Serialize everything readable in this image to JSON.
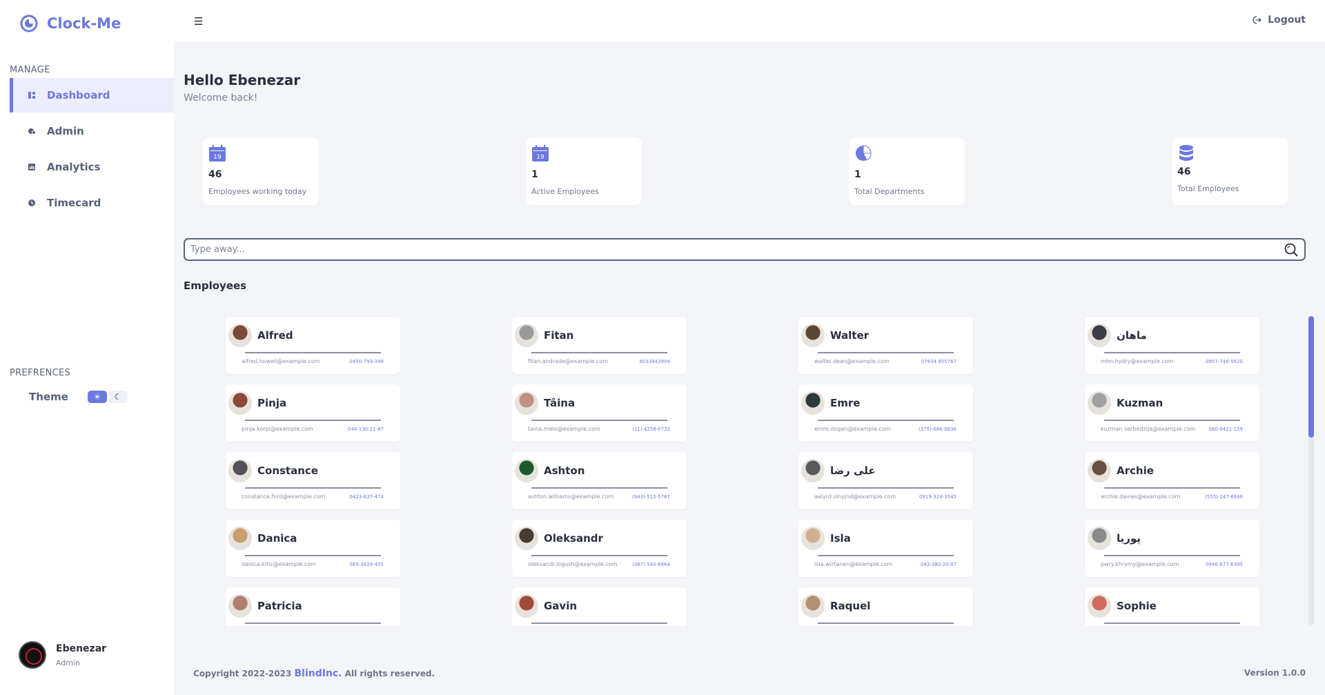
{
  "brand": {
    "name": "Clock-Me",
    "accent": "#6c78e0"
  },
  "sidebar": {
    "manage_label": "MANAGE",
    "items": [
      {
        "label": "Dashboard",
        "icon": "dashboard-icon",
        "active": true
      },
      {
        "label": "Admin",
        "icon": "admin-icon",
        "active": false
      },
      {
        "label": "Analytics",
        "icon": "analytics-icon",
        "active": false
      },
      {
        "label": "Timecard",
        "icon": "clock-icon",
        "active": false
      }
    ],
    "preferences_label": "PREFRENCES",
    "theme_label": "Theme",
    "theme_mode": "light"
  },
  "user": {
    "name": "Ebenezar",
    "role": "Admin"
  },
  "topbar": {
    "logout_label": "Logout"
  },
  "greeting": {
    "title": "Hello Ebenezar",
    "subtitle": "Welcome back!"
  },
  "stats": [
    {
      "value": "46",
      "label": "Employees working today",
      "icon": "calendar-icon",
      "icon_text": "19"
    },
    {
      "value": "1",
      "label": "Active Employees",
      "icon": "calendar-icon",
      "icon_text": "19"
    },
    {
      "value": "1",
      "label": "Total Departments",
      "icon": "pie-chart-icon"
    },
    {
      "value": "46",
      "label": "Total Employees",
      "icon": "database-icon"
    }
  ],
  "search": {
    "placeholder": "Type away..."
  },
  "employees_heading": "Employees",
  "employees": [
    {
      "name": "Alfred",
      "email": "alfred.howell@example.com",
      "phone": "0450-793-398",
      "avatar_color": "#7a4a3a"
    },
    {
      "name": "Fitan",
      "email": "fitan.andrade@example.com",
      "phone": "8033943904",
      "avatar_color": "#9a9a9a"
    },
    {
      "name": "Walter",
      "email": "walter.dean@example.com",
      "phone": "07634 955767",
      "avatar_color": "#5a4636"
    },
    {
      "name": "ماهان",
      "email": "mhn.hydry@example.com",
      "phone": "0957-746-5620",
      "avatar_color": "#3c3c46"
    },
    {
      "name": "Pinja",
      "email": "pinja.korpi@example.com",
      "phone": "044-130-21-87",
      "avatar_color": "#8a4a3a"
    },
    {
      "name": "Tâina",
      "email": "taina.melo@example.com",
      "phone": "(11) 4258-0733",
      "avatar_color": "#c09080"
    },
    {
      "name": "Emre",
      "email": "emre.dogan@example.com",
      "phone": "(375)-686-0836",
      "avatar_color": "#2e3a3a"
    },
    {
      "name": "Kuzman",
      "email": "kuzman.serbedzija@example.com",
      "phone": "060-9421-159",
      "avatar_color": "#a0a0a0"
    },
    {
      "name": "Constance",
      "email": "constance.ford@example.com",
      "phone": "0423-637-474",
      "avatar_color": "#555058"
    },
    {
      "name": "Ashton",
      "email": "ashton.williams@example.com",
      "phone": "(943)-512-5767",
      "avatar_color": "#1e5a2e"
    },
    {
      "name": "علی رضا",
      "email": "aalyrd.slnyjnd@example.com",
      "phone": "0919-324-3545",
      "avatar_color": "#5a5a5a"
    },
    {
      "name": "Archie",
      "email": "archie.davies@example.com",
      "phone": "(555)-147-6946",
      "avatar_color": "#6a5040"
    },
    {
      "name": "Danica",
      "email": "danica.kitic@example.com",
      "phone": "065-3828-455",
      "avatar_color": "#c8a070"
    },
    {
      "name": "Oleksandr",
      "email": "oleksandr.logush@example.com",
      "phone": "(067) 540-6864",
      "avatar_color": "#4a3a30"
    },
    {
      "name": "Isla",
      "email": "isla.wirtanen@example.com",
      "phone": "043-380-20-07",
      "avatar_color": "#d0b090"
    },
    {
      "name": "پوریا",
      "email": "pwry.khrymy@example.com",
      "phone": "0946-877-6395",
      "avatar_color": "#8a8a8a"
    },
    {
      "name": "Patricia",
      "email": "",
      "phone": "",
      "avatar_color": "#b08070"
    },
    {
      "name": "Gavin",
      "email": "",
      "phone": "",
      "avatar_color": "#a04a3a"
    },
    {
      "name": "Raquel",
      "email": "",
      "phone": "",
      "avatar_color": "#b09070"
    },
    {
      "name": "Sophie",
      "email": "",
      "phone": "",
      "avatar_color": "#d06a5a"
    }
  ],
  "footer": {
    "copyright_prefix": "Copyright 2022-2023 ",
    "brand_link": "BlindInc.",
    "copyright_suffix": " All rights reserved.",
    "version": "Version 1.0.0"
  }
}
